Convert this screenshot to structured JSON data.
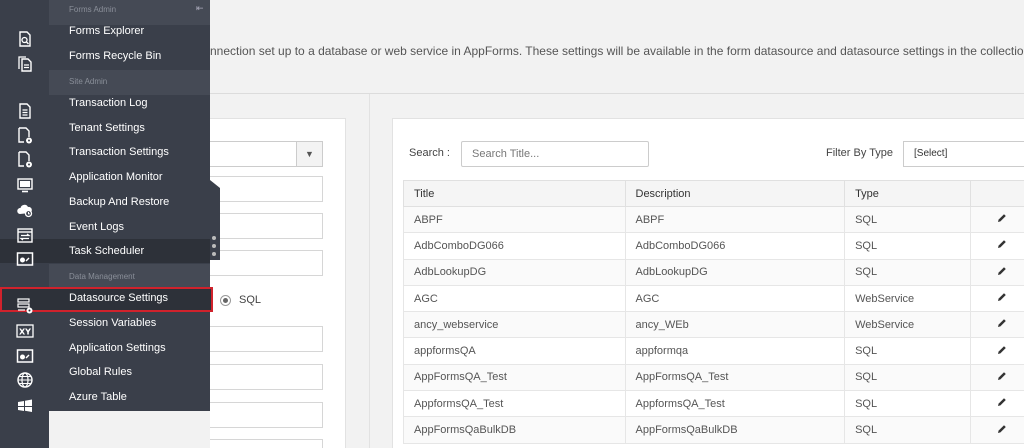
{
  "page": {
    "description": "nnection set up to a database or web service in AppForms. These settings will be available in the form datasource and datasource settings in the collection controls like Search Gr"
  },
  "form": {
    "radio_label": "SQL"
  },
  "search": {
    "label": "Search :",
    "placeholder": "Search Title..."
  },
  "filter": {
    "label": "Filter By Type",
    "selected": "[Select]"
  },
  "table": {
    "columns": [
      "Title",
      "Description",
      "Type",
      ""
    ],
    "rows": [
      {
        "title": "ABPF",
        "description": "ABPF",
        "type": "SQL"
      },
      {
        "title": "AdbComboDG066",
        "description": "AdbComboDG066",
        "type": "SQL"
      },
      {
        "title": "AdbLookupDG",
        "description": "AdbLookupDG",
        "type": "SQL"
      },
      {
        "title": "AGC",
        "description": "AGC",
        "type": "WebService"
      },
      {
        "title": "ancy_webservice",
        "description": "ancy_WEb",
        "type": "WebService"
      },
      {
        "title": "appformsQA",
        "description": "appformqa",
        "type": "SQL"
      },
      {
        "title": "AppFormsQA_Test",
        "description": "AppFormsQA_Test",
        "type": "SQL"
      },
      {
        "title": "AppformsQA_Test",
        "description": "AppformsQA_Test",
        "type": "SQL"
      },
      {
        "title": "AppFormsQaBulkDB",
        "description": "AppFormsQaBulkDB",
        "type": "SQL"
      }
    ]
  },
  "sidebar": {
    "sections": [
      "Forms Admin",
      "Site Admin",
      "Data Management"
    ],
    "items": [
      "Forms Explorer",
      "Forms Recycle Bin",
      "Transaction Log",
      "Tenant Settings",
      "Transaction Settings",
      "Application Monitor",
      "Backup And Restore",
      "Event Logs",
      "Task Scheduler",
      "Datasource Settings",
      "Session Variables",
      "Application Settings",
      "Global Rules",
      "Azure Table"
    ],
    "active_item": "Task Scheduler",
    "selected_item": "Datasource Settings"
  },
  "colors": {
    "sidebar_bg": "#3a3f4a",
    "highlight_border": "#d0222c"
  },
  "icons": [
    "pin-icon",
    "caret-down-icon",
    "pencil-icon",
    "document-search-icon",
    "document-copy-icon",
    "document-list-icon",
    "document-gear-icon",
    "monitor-icon",
    "cloud-backup-icon",
    "event-log-icon",
    "task-scheduler-icon",
    "datasource-settings-icon",
    "xy-variables-icon",
    "application-settings-icon",
    "globe-icon",
    "azure-table-icon"
  ]
}
